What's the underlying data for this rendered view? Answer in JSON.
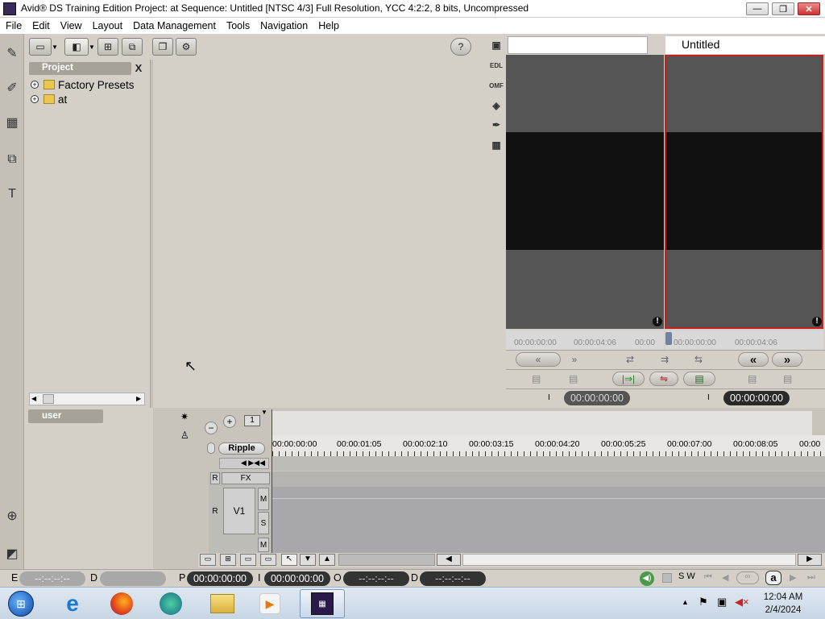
{
  "window": {
    "title": "Avid® DS Training Edition Project: at     Sequence: Untitled     [NTSC 4/3]    Full Resolution, YCC 4:2:2, 8 bits, Uncompressed",
    "controls": {
      "minimize": "—",
      "restore": "❐",
      "close": "✕"
    }
  },
  "menu": [
    "File",
    "Edit",
    "View",
    "Layout",
    "Data Management",
    "Tools",
    "Navigation",
    "Help"
  ],
  "toolbar": {
    "help_label": "?"
  },
  "project_panel": {
    "tab_label": "Project",
    "close_label": "X",
    "items": [
      {
        "label": "Factory Presets"
      },
      {
        "label": "at"
      }
    ],
    "user_tab_label": "user"
  },
  "viewer": {
    "record_sequence_name": "Untitled",
    "icons": [
      "EDL",
      "OMF"
    ],
    "source_ruler": [
      "00:00:00:00",
      "00:00:04:06",
      "00:00"
    ],
    "record_ruler": [
      "00:00:00:00",
      "00:00:04:06"
    ],
    "source_tc": "00:00:00:00",
    "record_tc": "00:00:00:00",
    "mark_label": "I"
  },
  "timeline": {
    "ripple_label": "Ripple",
    "ruler_ticks": [
      "00:00:00:00",
      "00:00:01:05",
      "00:00:02:10",
      "00:00:03:15",
      "00:00:04:20",
      "00:00:05:25",
      "00:00:07:00",
      "00:00:08:05",
      "00:00"
    ],
    "track_header": {
      "r": "R",
      "fx": "FX",
      "track_name": "V1",
      "m": "M",
      "s": "S"
    }
  },
  "statusbar": {
    "e_label": "E",
    "e_value": "--:--:--:--",
    "d_label": "D",
    "p_label": "P",
    "p_value": "00:00:00:00",
    "i_label": "I",
    "i_value": "00:00:00:00",
    "o_label": "O",
    "o_value": "--:--:--:--",
    "d2_label": "D",
    "d2_value": "--:--:--:--",
    "sw_label": "S W",
    "a_label": "a"
  },
  "taskbar": {
    "time": "12:04 AM",
    "date": "2/4/2024"
  },
  "colors": {
    "panel_bg": "#d4d0c8",
    "record_border": "#c02020",
    "taskbar_bg": "#c8d6e4"
  }
}
